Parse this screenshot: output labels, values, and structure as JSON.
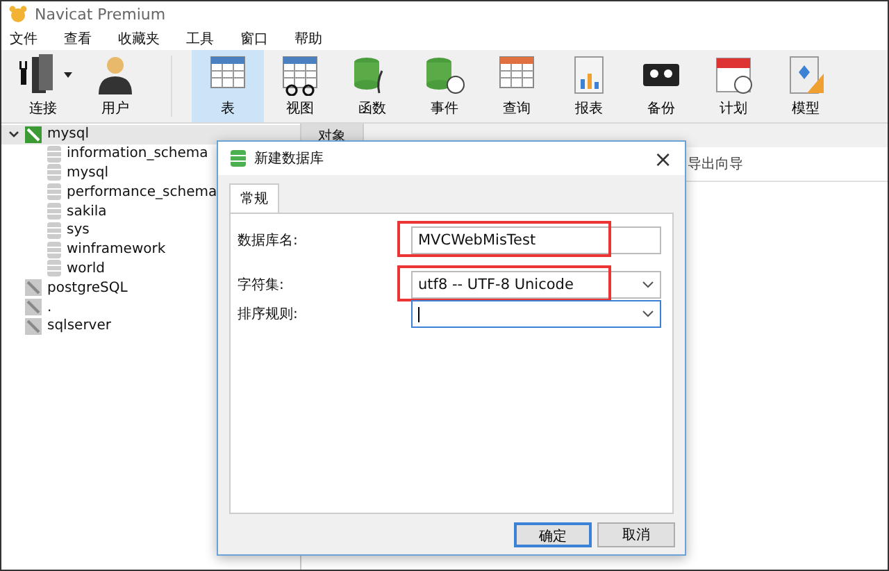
{
  "window": {
    "title": "Navicat Premium"
  },
  "menu": [
    "文件",
    "查看",
    "收藏夹",
    "工具",
    "窗口",
    "帮助"
  ],
  "toolbar": [
    {
      "label": "连接",
      "selected": false,
      "dropdown": true
    },
    {
      "label": "用户",
      "selected": false,
      "dropdown": false
    },
    {
      "label": "表",
      "selected": true,
      "dropdown": false
    },
    {
      "label": "视图",
      "selected": false,
      "dropdown": false
    },
    {
      "label": "函数",
      "selected": false,
      "dropdown": false
    },
    {
      "label": "事件",
      "selected": false,
      "dropdown": false
    },
    {
      "label": "查询",
      "selected": false,
      "dropdown": false
    },
    {
      "label": "报表",
      "selected": false,
      "dropdown": false
    },
    {
      "label": "备份",
      "selected": false,
      "dropdown": false
    },
    {
      "label": "计划",
      "selected": false,
      "dropdown": false
    },
    {
      "label": "模型",
      "selected": false,
      "dropdown": false
    }
  ],
  "sidebar": {
    "items": [
      {
        "label": "mysql",
        "open": true,
        "expanded": true,
        "children": [
          {
            "label": "information_schema"
          },
          {
            "label": "mysql"
          },
          {
            "label": "performance_schema"
          },
          {
            "label": "sakila"
          },
          {
            "label": "sys"
          },
          {
            "label": "winframework"
          },
          {
            "label": "world"
          }
        ]
      },
      {
        "label": "postgreSQL",
        "open": false,
        "expanded": false
      },
      {
        "label": ".",
        "open": false,
        "expanded": false
      },
      {
        "label": "sqlserver",
        "open": false,
        "expanded": false
      }
    ]
  },
  "main": {
    "tabs": [
      {
        "label": "对象",
        "selected": true
      }
    ],
    "toolbar_text": "导出向导"
  },
  "dialog": {
    "title": "新建数据库",
    "close": "×",
    "tabs": [
      {
        "label": "常规",
        "selected": true
      }
    ],
    "fields": [
      {
        "label": "数据库名:",
        "kind": "text",
        "value": "MVCWebMisTest",
        "highlighted": true,
        "focused": false
      },
      {
        "label": "字符集:",
        "kind": "select",
        "value": "utf8 -- UTF-8 Unicode",
        "highlighted": true,
        "focused": false
      },
      {
        "label": "排序规则:",
        "kind": "select",
        "highlighted": false,
        "focused": true
      }
    ],
    "buttons": [
      {
        "label": "确定",
        "default": true
      },
      {
        "label": "取消",
        "default": false
      }
    ]
  }
}
